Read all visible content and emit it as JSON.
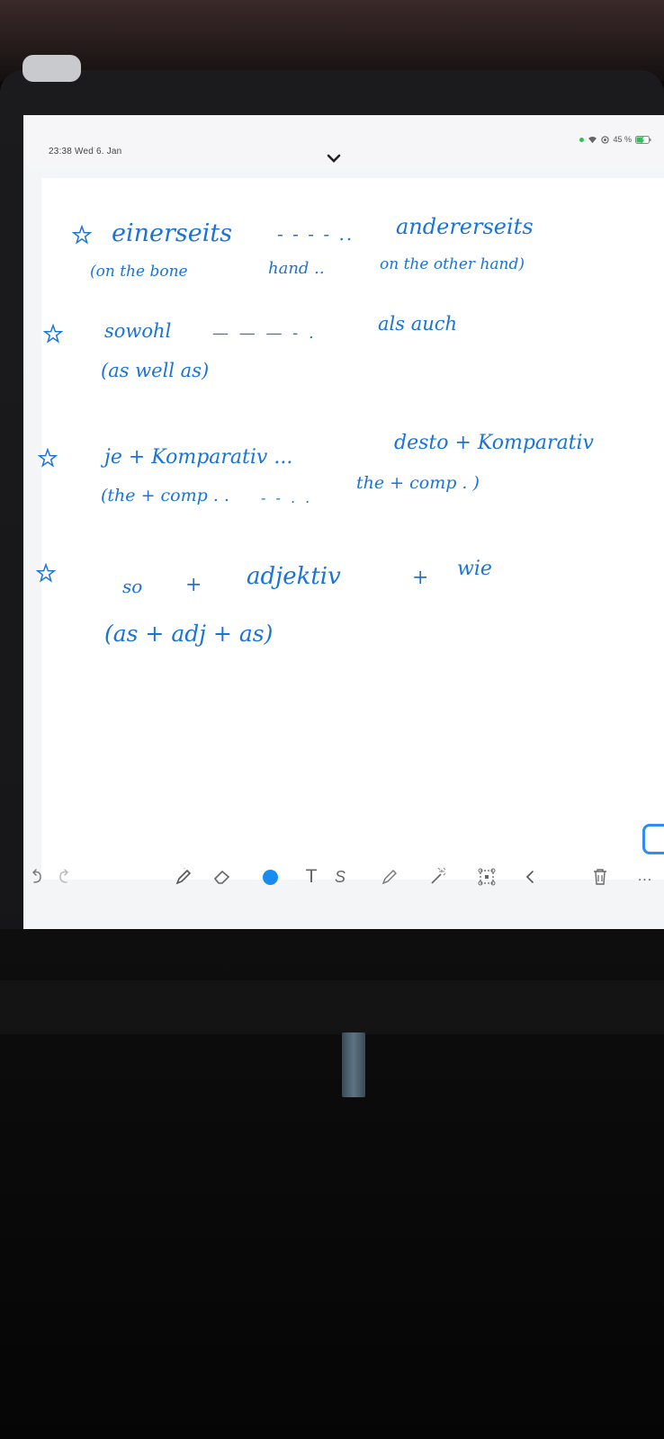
{
  "statusbar": {
    "time": "23:38",
    "date": "Wed 6. Jan",
    "battery": "45 %"
  },
  "notes": {
    "line1": "einerseits",
    "line1_dash": "- - - - ..",
    "line1_right": "andererseits",
    "line2": "(on the bone",
    "line2_mid": "hand ..",
    "line2_right": "on the other hand)",
    "line3": "sowohl",
    "line3_dash": "— — — - .",
    "line3_right": "als auch",
    "line4": "(as well as)",
    "line5": "je + Komparativ ...",
    "line5_right": "desto + Komparativ",
    "line6": "(the + comp . .",
    "line6_dash": "- - . .",
    "line6_right": "the + comp . )",
    "line7_so": "so",
    "line7_plus1": "+",
    "line7_adj": "adjektiv",
    "line7_plus2": "+",
    "line7_wie": "wie",
    "line8": "(as + adj + as)"
  },
  "toolbar": {
    "text_tool": "T",
    "s_tool": "S",
    "more": "..."
  },
  "colors": {
    "ink": "#1a73d6",
    "accent": "#1a8cf0"
  }
}
